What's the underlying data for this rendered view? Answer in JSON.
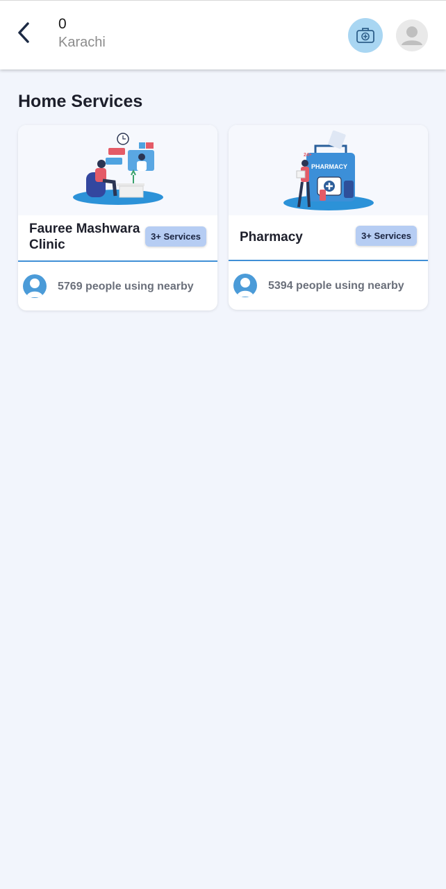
{
  "header": {
    "count": "0",
    "city": "Karachi"
  },
  "section": {
    "title": "Home Services"
  },
  "cards": [
    {
      "name_line1": "Fauree Mashwara",
      "name_line2": "Clinic",
      "badge": "3+ Services",
      "usage": "5769 people using nearby",
      "image_icon": "doctor-consultation-illustration"
    },
    {
      "name_line1": "Pharmacy",
      "badge": "3+ Services",
      "usage": "5394 people using nearby",
      "image_icon": "pharmacy-illustration",
      "image_text": "PHARMACY",
      "image_sign": "24+"
    }
  ],
  "colors": {
    "background": "#f2f5fc",
    "accent": "#3f8fd6",
    "badge": "#b6cdf3",
    "kit_button": "#a9d6f2"
  }
}
